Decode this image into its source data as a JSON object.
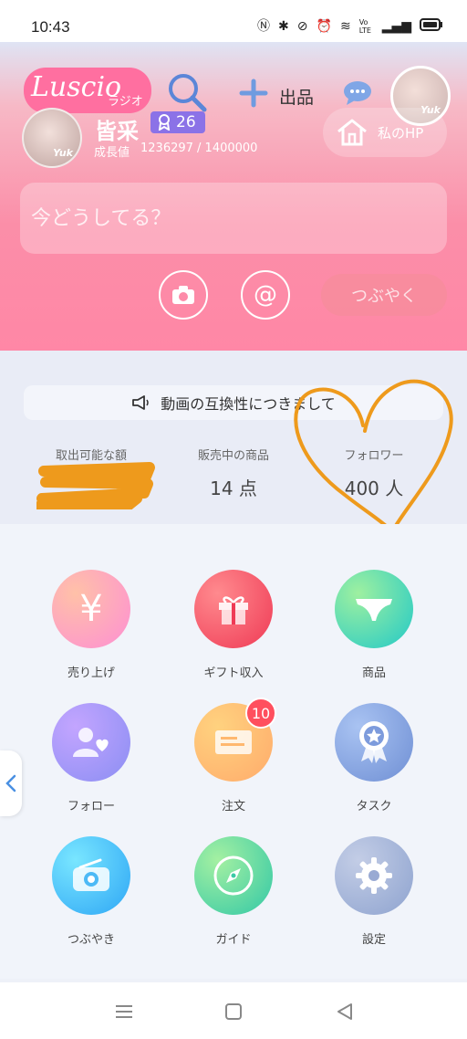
{
  "status_bar": {
    "time": "10:43",
    "icons": [
      "nfc-icon",
      "bluetooth-icon",
      "vibrate-off-icon",
      "alarm-icon",
      "wifi-icon",
      "volte-icon",
      "signal-icon",
      "battery-icon"
    ],
    "volte_text": "Vo LTE"
  },
  "header": {
    "logo_text": "Luscio",
    "logo_sub": "ラジオ",
    "post_label": "出品",
    "avatar_text": "Yuk"
  },
  "profile": {
    "name": "皆采",
    "rank": "26",
    "growth_label": "成長値",
    "growth_value": "1236297 / 1400000",
    "avatar_text": "Yuk",
    "hp_label": "私のHP"
  },
  "composer": {
    "placeholder": "今どうしてる？",
    "mention_symbol": "@",
    "tweet_label": "つぶやく"
  },
  "notice": {
    "text": "動画の互換性につきまして"
  },
  "stats": [
    {
      "label": "取出可能な額",
      "value": ""
    },
    {
      "label": "販売中の商品",
      "value": "14 点"
    },
    {
      "label": "フォロワー",
      "value": "400 人"
    }
  ],
  "menu": [
    {
      "label": "売り上げ",
      "icon": "yen-icon",
      "glyph": "¥"
    },
    {
      "label": "ギフト収入",
      "icon": "gift-icon"
    },
    {
      "label": "商品",
      "icon": "underwear-icon"
    },
    {
      "label": "フォロー",
      "icon": "follow-heart-icon"
    },
    {
      "label": "注文",
      "icon": "order-ticket-icon",
      "badge": "10"
    },
    {
      "label": "タスク",
      "icon": "award-ribbon-icon"
    },
    {
      "label": "つぶやき",
      "icon": "radio-icon"
    },
    {
      "label": "ガイド",
      "icon": "compass-icon"
    },
    {
      "label": "設定",
      "icon": "gear-icon"
    }
  ],
  "colors": {
    "accent_pink": "#ff87a6",
    "rank_purple": "#8b72e7",
    "doodle_orange": "#ee9a1c",
    "badge_red": "#ff4f5e"
  }
}
